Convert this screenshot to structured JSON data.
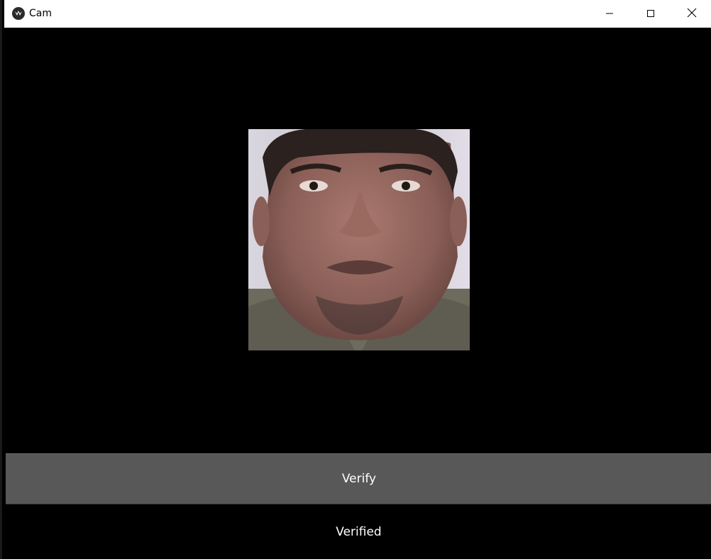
{
  "window": {
    "title": "Cam",
    "icon": "kivy-app-icon",
    "controls": {
      "minimize": "minimize-icon",
      "maximize": "maximize-icon",
      "close": "close-icon"
    }
  },
  "main": {
    "webcam_feed": "webcam-frame",
    "verify_button_label": "Verify",
    "status_text": "Verified"
  },
  "colors": {
    "background": "#000000",
    "button": "#585858",
    "text": "#ffffff",
    "titlebar": "#ffffff"
  }
}
